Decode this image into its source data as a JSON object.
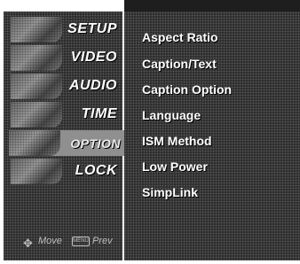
{
  "nav": {
    "items": [
      {
        "label": "SETUP",
        "active": false
      },
      {
        "label": "VIDEO",
        "active": false
      },
      {
        "label": "AUDIO",
        "active": false
      },
      {
        "label": "TIME",
        "active": false
      },
      {
        "label": "OPTION",
        "active": true
      },
      {
        "label": "LOCK",
        "active": false
      }
    ]
  },
  "options": {
    "items": [
      "Aspect Ratio",
      "Caption/Text",
      "Caption Option",
      "Language",
      "ISM Method",
      "Low Power",
      "SimpLink"
    ]
  },
  "footer": {
    "move_label": "Move",
    "prev_label": "Prev",
    "move_icon": "navigation-dpad-icon",
    "prev_icon": "menu-key-icon",
    "menu_key_text": "MENU"
  },
  "colors": {
    "panel": "#2e2e2e",
    "active_item": "#8f8f8f",
    "text": "#ffffff"
  }
}
